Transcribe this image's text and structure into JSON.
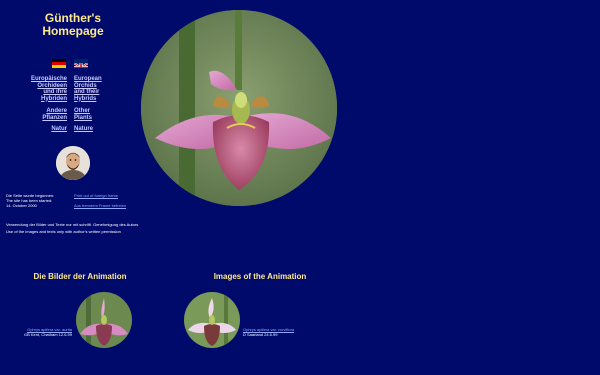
{
  "header": {
    "title_line1": "Günther's",
    "title_line2": "Homepage"
  },
  "nav": {
    "de_orchids": [
      "Europäische",
      "Orchideen",
      "und ihre",
      "Hybriden"
    ],
    "en_orchids": [
      "European",
      "Orchids",
      "and their",
      "Hybrids"
    ],
    "de_plants": [
      "Andere",
      "Pflanzen"
    ],
    "en_plants": [
      "Other",
      "Plants"
    ],
    "de_nature": "Natur",
    "en_nature": "Nature"
  },
  "info": {
    "started_de": "Die Seite wurde begonnen:",
    "started_en": "The site has been started:",
    "date": "14. October 2000",
    "print_frame": "Print out of foreign frame",
    "exit_frame": "Aus fremdem Frame befreien",
    "copyright_de": "Verwendung der Bilder und Texte nur mit schriftl. Genehmigung des Autors",
    "copyright_en": "Use of the images and texts only with author's written permission"
  },
  "animation": {
    "heading_de": "Die Bilder der Animation",
    "heading_en": "Images of the Animation",
    "left": {
      "name": "Ophrys apifera var. aurita",
      "place": "GB Kent, Chatham 12.6.99"
    },
    "right": {
      "name": "Ophrys apifera var. curviflora",
      "place": "D Saarland 24.5.99"
    }
  },
  "colors": {
    "background": "#000a6b",
    "title": "#ffe98a",
    "link": "#8fa8ff"
  }
}
